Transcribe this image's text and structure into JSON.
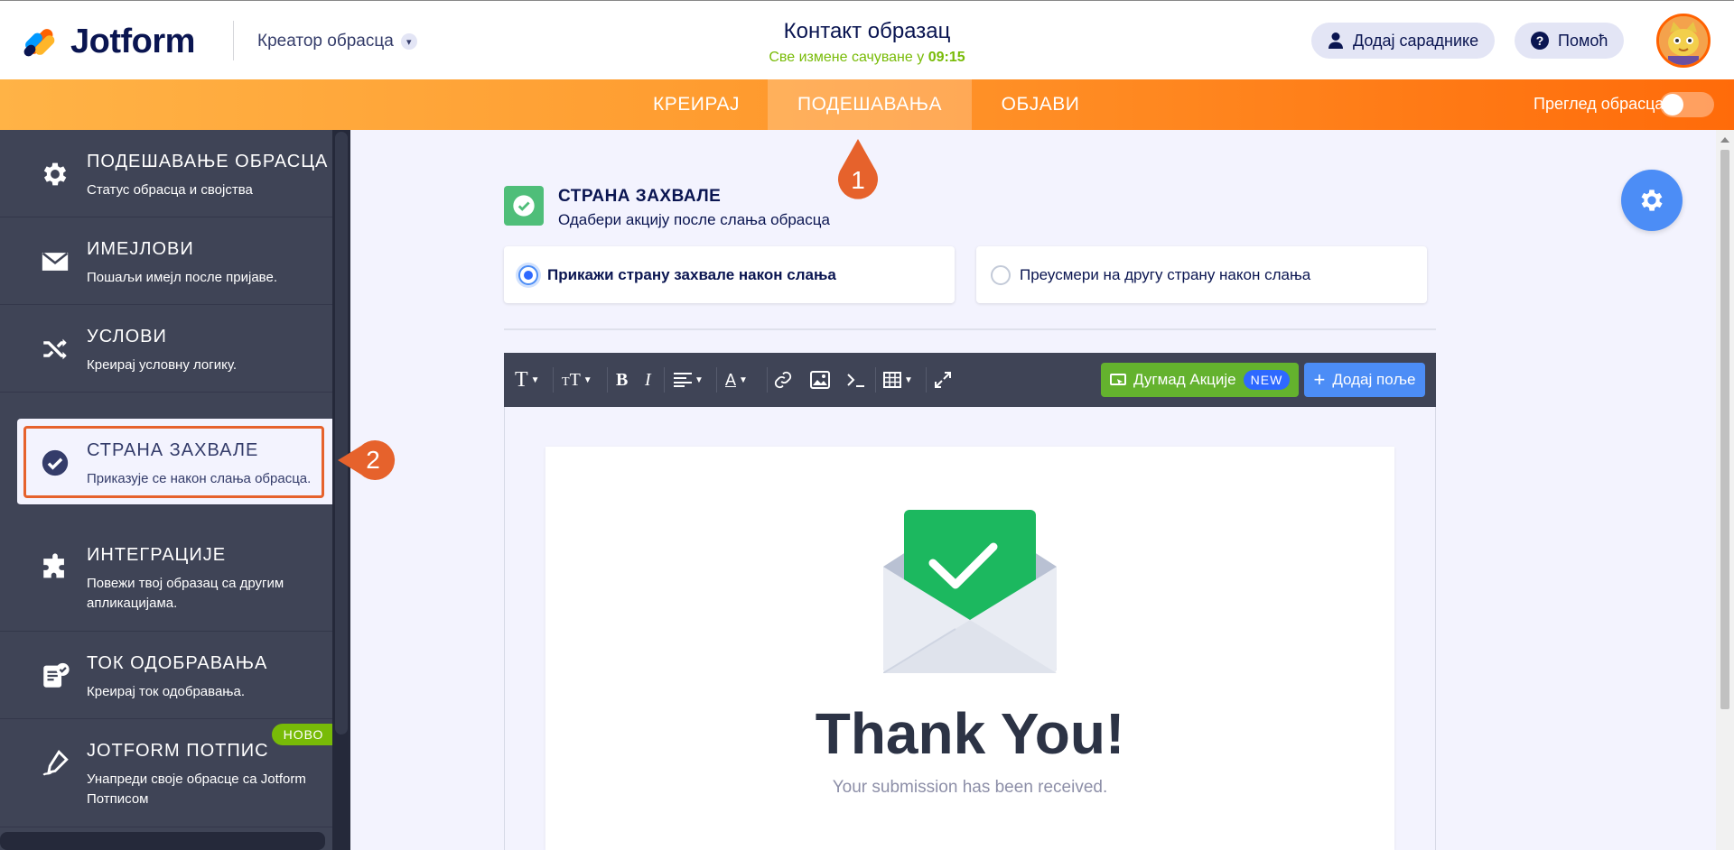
{
  "header": {
    "logo_text": "Jotform",
    "creator_label": "Креатор обрасца",
    "form_title": "Контакт образац",
    "saved_text": "Све измене сачуване у",
    "saved_time": "09:15",
    "add_collaborators": "Додај сараднике",
    "help": "Помоћ"
  },
  "nav": {
    "tabs": [
      "КРЕИРАЈ",
      "ПОДЕШАВАЊА",
      "ОБЈАВИ"
    ],
    "active_tab": "ПОДЕШАВАЊА",
    "preview_label": "Преглед обрасца"
  },
  "sidebar": {
    "items": [
      {
        "title": "ПОДЕШАВАЊЕ ОБРАСЦА",
        "desc": "Статус обрасца и својства",
        "icon": "gear-icon"
      },
      {
        "title": "ИМЕЈЛОВИ",
        "desc": "Пошаљи имејл после пријаве.",
        "icon": "envelope-icon"
      },
      {
        "title": "УСЛОВИ",
        "desc": "Креирај условну логику.",
        "icon": "shuffle-icon"
      },
      {
        "title": "СТРАНА ЗАХВАЛЕ",
        "desc": "Приказује се након слања обрасца.",
        "icon": "check-circle-icon"
      },
      {
        "title": "ИНТЕГРАЦИЈЕ",
        "desc": "Повежи твој образац са другим апликацијама.",
        "icon": "puzzle-icon"
      },
      {
        "title": "ТОК ОДОБРАВАЊА",
        "desc": "Креирај ток одобравања.",
        "icon": "approval-icon"
      },
      {
        "title": "JOTFORM ПОТПИС",
        "desc": "Унапреди своје обрасце са Jotform Потписом",
        "icon": "pen-icon"
      }
    ],
    "new_badge": "НОВО"
  },
  "callouts": {
    "first": "1",
    "second": "2"
  },
  "thankyou": {
    "section_title": "СТРАНА ЗАХВАЛЕ",
    "section_subtitle": "Одабери акцију после слања обрасца",
    "option_show": "Прикажи страну захвале након слања",
    "option_redirect": "Преусмери на другу страну након слања",
    "selected": "show"
  },
  "toolbar": {
    "action_buttons": "Дугмад Акције",
    "new_pill": "NEW",
    "add_field": "Додај поље"
  },
  "content": {
    "heading": "Thank You!",
    "message": "Your submission has been received."
  },
  "colors": {
    "brand_navy": "#0a1551",
    "accent_orange": "#ff6100",
    "success_green": "#4fbe79",
    "primary_blue": "#4c8df6",
    "sidebar_bg": "#3f4456",
    "callout": "#e6622c"
  }
}
